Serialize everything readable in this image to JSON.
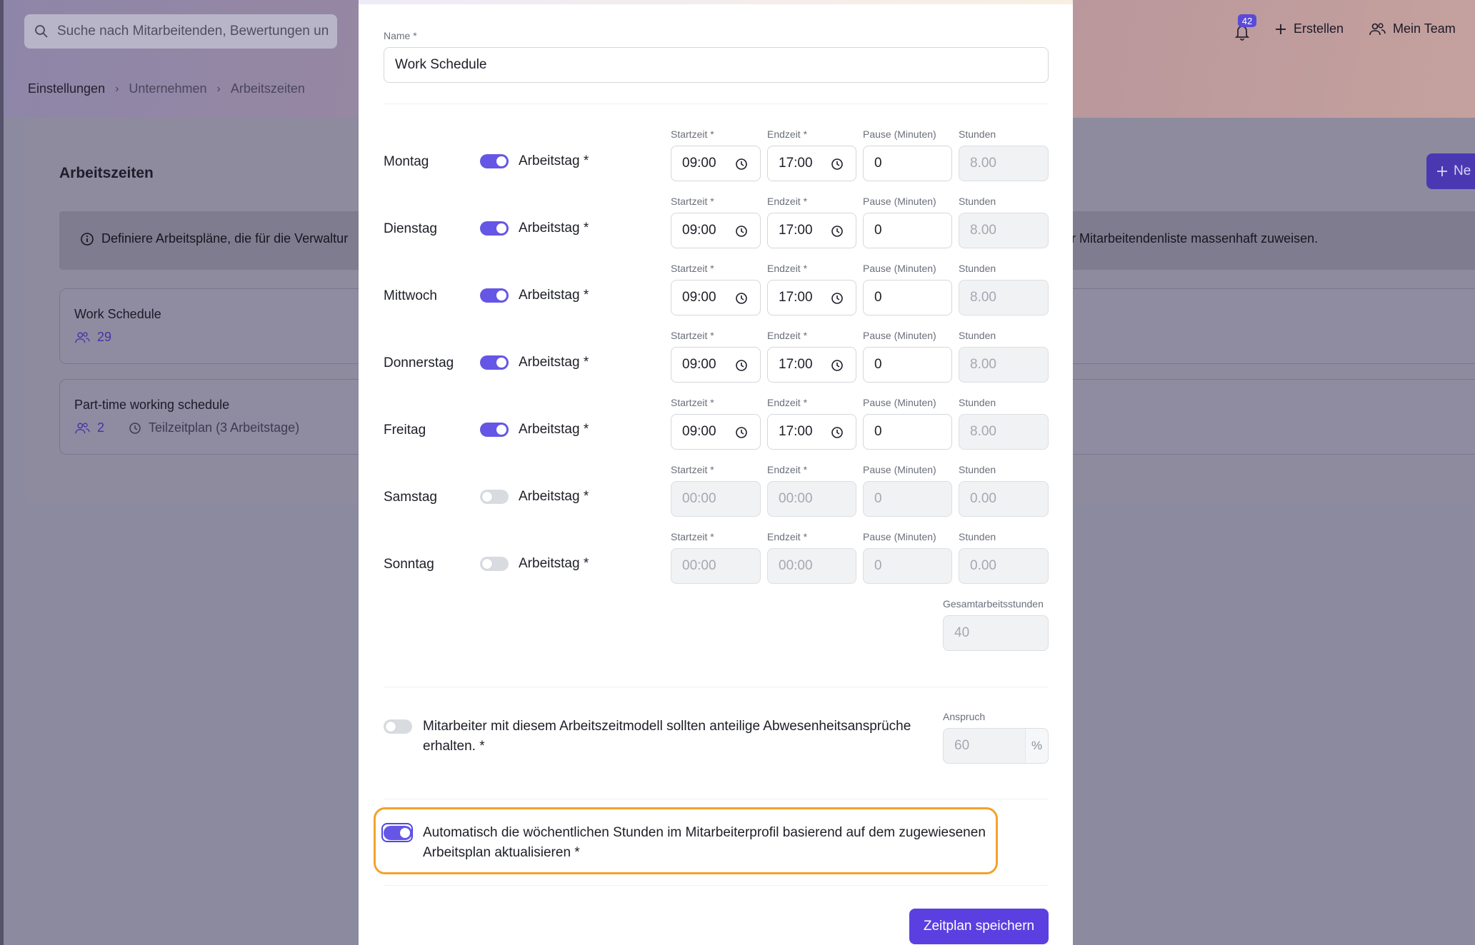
{
  "topbar": {
    "search_placeholder": "Suche nach Mitarbeitenden, Bewertungen un",
    "notifications_count": "42",
    "create_label": "Erstellen",
    "team_label": "Mein Team"
  },
  "breadcrumb": [
    "Einstellungen",
    "Unternehmen",
    "Arbeitszeiten"
  ],
  "page": {
    "title": "Arbeitszeiten",
    "new_button": "Ne",
    "info_left": "Definiere Arbeitspläne, die für die Verwaltur",
    "info_right": "r Mitarbeitendenliste massenhaft zuweisen.",
    "schedules": [
      {
        "name": "Work Schedule",
        "count": "29",
        "detail": ""
      },
      {
        "name": "Part-time working schedule",
        "count": "2",
        "detail": "Teilzeitplan (3 Arbeitstage)"
      }
    ]
  },
  "modal": {
    "name_label": "Name *",
    "name_value": "Work Schedule",
    "col_labels": {
      "start": "Startzeit *",
      "end": "Endzeit *",
      "pause": "Pause (Minuten)",
      "hours": "Stunden"
    },
    "workday_label": "Arbeitstag *",
    "days": [
      {
        "name": "Montag",
        "on": true,
        "start": "09:00",
        "end": "17:00",
        "pause": "0",
        "hours": "8.00"
      },
      {
        "name": "Dienstag",
        "on": true,
        "start": "09:00",
        "end": "17:00",
        "pause": "0",
        "hours": "8.00"
      },
      {
        "name": "Mittwoch",
        "on": true,
        "start": "09:00",
        "end": "17:00",
        "pause": "0",
        "hours": "8.00"
      },
      {
        "name": "Donnerstag",
        "on": true,
        "start": "09:00",
        "end": "17:00",
        "pause": "0",
        "hours": "8.00"
      },
      {
        "name": "Freitag",
        "on": true,
        "start": "09:00",
        "end": "17:00",
        "pause": "0",
        "hours": "8.00"
      },
      {
        "name": "Samstag",
        "on": false,
        "start": "00:00",
        "end": "00:00",
        "pause": "0",
        "hours": "0.00"
      },
      {
        "name": "Sonntag",
        "on": false,
        "start": "00:00",
        "end": "00:00",
        "pause": "0",
        "hours": "0.00"
      }
    ],
    "total_label": "Gesamtarbeitsstunden",
    "total_value": "40",
    "prorata_text_1": "Mitarbeiter mit diesem Arbeitszeitmodell sollten anteilige Abwesenheitsansprüche",
    "prorata_text_2": "erhalten. *",
    "prorata_on": false,
    "entitlement_label": "Anspruch",
    "entitlement_value": "60",
    "entitlement_unit": "%",
    "auto_text_1": "Automatisch die wöchentlichen Stunden im Mitarbeiterprofil basierend auf dem zugewiesenen",
    "auto_text_2": "Arbeitsplan aktualisieren *",
    "auto_on": true,
    "save_label": "Zeitplan speichern"
  },
  "colors": {
    "accent": "#6556e6",
    "save_button": "#5b3fe0",
    "highlight": "#f2a22e"
  }
}
